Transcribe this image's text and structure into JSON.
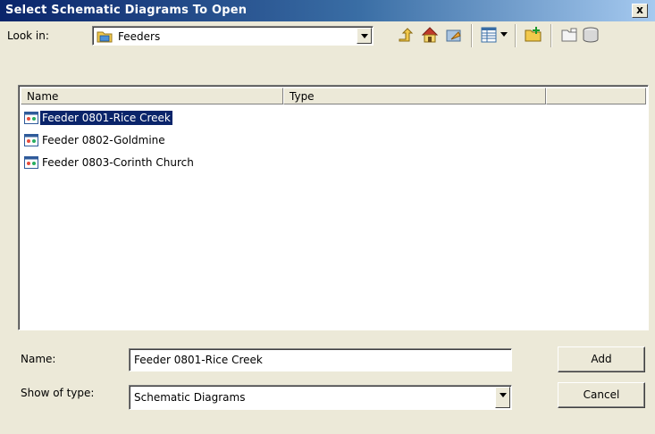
{
  "dialog": {
    "title": "Select Schematic Diagrams To Open",
    "close_glyph": "x"
  },
  "look_in": {
    "label": "Look in:",
    "value": "Feeders",
    "icon": "folder-icon"
  },
  "toolbar": {
    "icons": [
      "up-one-level-icon",
      "home-icon",
      "connect-folder-icon",
      "view-details-icon",
      "new-folder-icon",
      "properties-icon",
      "delete-icon"
    ]
  },
  "list": {
    "columns": [
      "Name",
      "Type"
    ],
    "items": [
      {
        "name": "Feeder 0801-Rice Creek",
        "type": "",
        "selected": true
      },
      {
        "name": "Feeder 0802-Goldmine",
        "type": "",
        "selected": false
      },
      {
        "name": "Feeder 0803-Corinth Church",
        "type": "",
        "selected": false
      }
    ]
  },
  "name_field": {
    "label": "Name:",
    "value": "Feeder 0801-Rice Creek"
  },
  "type_field": {
    "label": "Show of type:",
    "value": "Schematic Diagrams"
  },
  "buttons": {
    "add": "Add",
    "cancel": "Cancel"
  },
  "colors": {
    "selection": "#0a246a",
    "face": "#ece9d8",
    "title_start": "#0a246a",
    "title_end": "#a6caf0"
  }
}
